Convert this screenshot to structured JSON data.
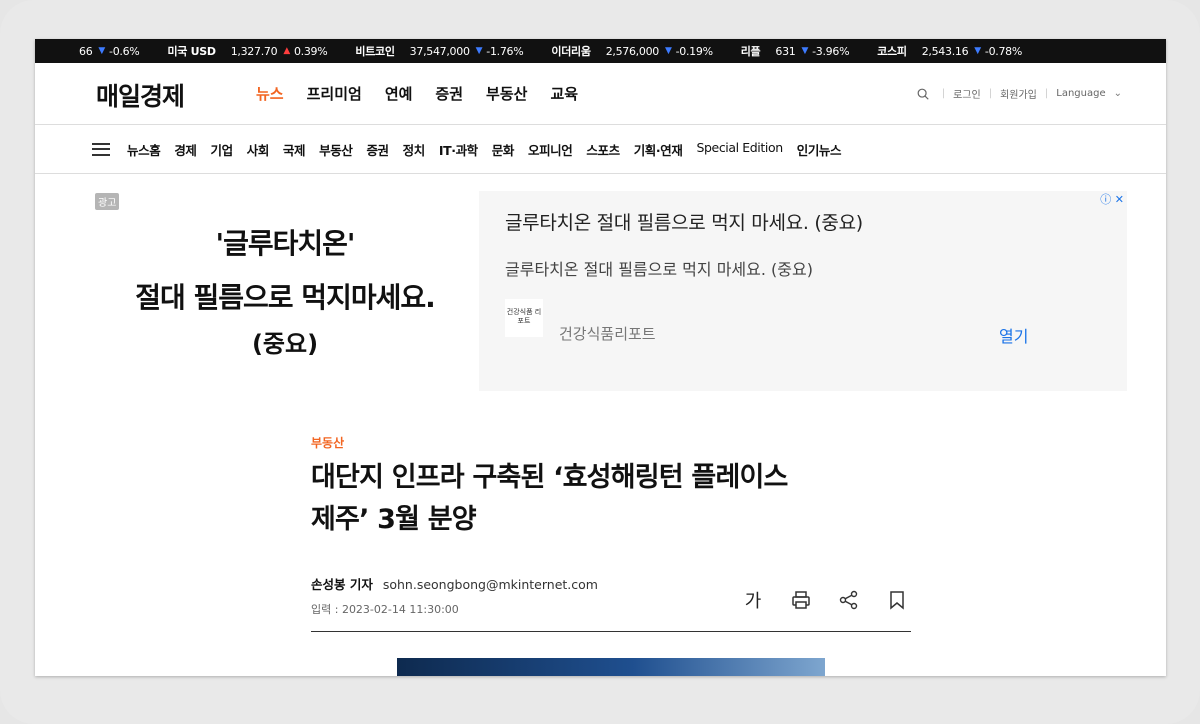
{
  "ticker": [
    {
      "name": "",
      "value": "66",
      "dir": "down",
      "change": "-0.6%"
    },
    {
      "name": "미국 USD",
      "value": "1,327.70",
      "dir": "up",
      "change": "0.39%"
    },
    {
      "name": "비트코인",
      "value": "37,547,000",
      "dir": "down",
      "change": "-1.76%"
    },
    {
      "name": "이더리움",
      "value": "2,576,000",
      "dir": "down",
      "change": "-0.19%"
    },
    {
      "name": "리플",
      "value": "631",
      "dir": "down",
      "change": "-3.96%"
    },
    {
      "name": "코스피",
      "value": "2,543.16",
      "dir": "down",
      "change": "-0.78%"
    }
  ],
  "header": {
    "logo": "매일경제",
    "nav": [
      "뉴스",
      "프리미엄",
      "연예",
      "증권",
      "부동산",
      "교육"
    ],
    "active_nav": "뉴스",
    "login": "로그인",
    "signup": "회원가입",
    "language": "Language"
  },
  "subnav": [
    "뉴스홈",
    "경제",
    "기업",
    "사회",
    "국제",
    "부동산",
    "증권",
    "정치",
    "IT·과학",
    "문화",
    "오피니언",
    "스포츠",
    "기획·연재",
    "Special Edition",
    "인기뉴스"
  ],
  "ad": {
    "badge": "광고",
    "line1": "'글루타치온'",
    "line2": "절대 필름으로 먹지마세요.",
    "line3": "(중요)",
    "title": "글루타치온 절대 필름으로 먹지 마세요. (중요)",
    "desc": "글루타치온 절대 필름으로 먹지 마세요. (중요)",
    "thumb_text": "건강식품 리포트",
    "source": "건강식품리포트",
    "open": "열기"
  },
  "article": {
    "section": "부동산",
    "headline_1": "대단지 인프라 구축된 ‘효성해링턴 플레이스",
    "headline_2": "제주’ 3월 분양",
    "reporter": "손성봉 기자",
    "email": "sohn.seongbong@mkinternet.com",
    "date": "입력 : 2023-02-14 11:30:00",
    "font_label": "가"
  },
  "colors": {
    "accent": "#f26522",
    "down": "#3d7bff",
    "up": "#ff3d3d",
    "link": "#1a73e8"
  }
}
